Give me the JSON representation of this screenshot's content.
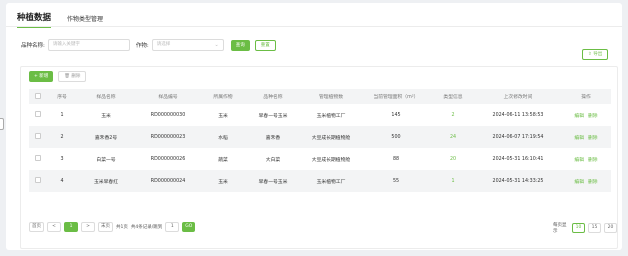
{
  "tabs": {
    "active": "种植数据",
    "other": "作物类型管理"
  },
  "filter": {
    "name_label": "品种名称:",
    "name_placeholder": "请输入关键字",
    "crop_label": "作物:",
    "crop_placeholder": "请选择",
    "query_label": "查询",
    "reset_label": "重置",
    "export_label": "导出"
  },
  "actions": {
    "add_label": "新增",
    "delete_label": "删除"
  },
  "table": {
    "headers": [
      "序号",
      "样品名称",
      "样品编号",
      "所属作物",
      "品种名称",
      "管理植物数",
      "当前管理面积（m²）",
      "类型信息",
      "上次修改时间",
      "操作"
    ],
    "rows": [
      {
        "no": "1",
        "sample": "玉米",
        "code": "RD000000030",
        "crop": "玉米",
        "variety": "早春一号玉米",
        "plant": "玉米植物工厂",
        "area": "145",
        "type_info": "2",
        "time": "2024-06-11 13:58:53",
        "edit": "编辑",
        "del": "删除"
      },
      {
        "no": "2",
        "sample": "嘉禾香2号",
        "code": "RD000000023",
        "crop": "水稻",
        "variety": "嘉禾香",
        "plant": "大豆成长期植物舱",
        "area": "500",
        "type_info": "24",
        "time": "2024-06-07 17:19:54",
        "edit": "编辑",
        "del": "删除"
      },
      {
        "no": "3",
        "sample": "白菜一号",
        "code": "RD000000026",
        "crop": "蔬菜",
        "variety": "大白菜",
        "plant": "大豆成长期植物舱",
        "area": "88",
        "type_info": "20",
        "time": "2024-05-31 16:10:41",
        "edit": "编辑",
        "del": "删除"
      },
      {
        "no": "4",
        "sample": "玉米早春红",
        "code": "RD000000024",
        "crop": "玉米",
        "variety": "早春一号玉米",
        "plant": "玉米植物工厂",
        "area": "55",
        "type_info": "1",
        "time": "2024-05-31 14:33:25",
        "edit": "编辑",
        "del": "删除"
      }
    ]
  },
  "pager": {
    "first": "首页",
    "prev": "<",
    "current": "1",
    "next": ">",
    "last": "末页",
    "total_pages": "共1页",
    "total_records": "共4条记录/跳到",
    "goto_value": "1",
    "go": "GO",
    "per_page_label": "每页显示",
    "sizes": [
      "10",
      "15",
      "20"
    ]
  },
  "colors": {
    "accent": "#6bbd45"
  }
}
